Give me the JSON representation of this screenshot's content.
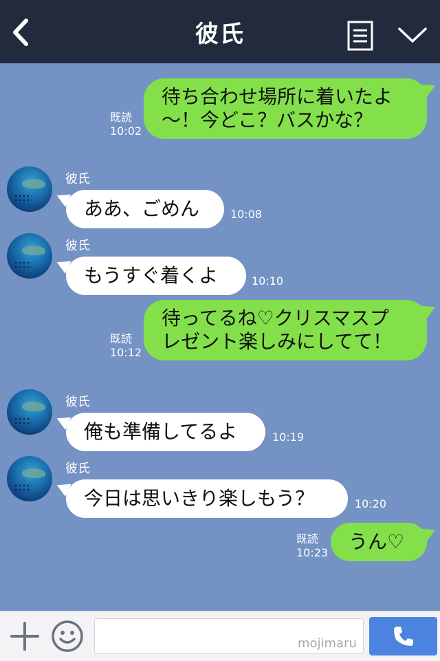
{
  "header": {
    "title": "彼氏",
    "back_icon": "chevron-left-icon",
    "memo_icon": "memo-icon",
    "menu_icon": "chevron-down-icon"
  },
  "messages": [
    {
      "side": "me",
      "lines": [
        "待ち合わせ場所に着いたよ",
        "〜！今どこ？バスかな？"
      ],
      "read": "既読",
      "time": "10:02"
    },
    {
      "side": "them",
      "sender": "彼氏",
      "lines": [
        "ああ、ごめん"
      ],
      "time": "10:08"
    },
    {
      "side": "them",
      "sender": "彼氏",
      "lines": [
        "もうすぐ着くよ"
      ],
      "time": "10:10"
    },
    {
      "side": "me",
      "lines": [
        "待ってるね♡クリスマスプ",
        "レゼント楽しみにしてて！"
      ],
      "read": "既読",
      "time": "10:12"
    },
    {
      "side": "them",
      "sender": "彼氏",
      "lines": [
        "俺も準備してるよ"
      ],
      "time": "10:19"
    },
    {
      "side": "them",
      "sender": "彼氏",
      "lines": [
        "今日は思いきり楽しもう？"
      ],
      "time": "10:20"
    },
    {
      "side": "me",
      "lines": [
        "うん♡"
      ],
      "read": "既読",
      "time": "10:23"
    }
  ],
  "footer": {
    "input_value": "",
    "watermark": "mojimaru",
    "plus_icon": "plus-icon",
    "emoji_icon": "smiley-icon",
    "call_icon": "phone-icon"
  },
  "colors": {
    "header_bg": "#222b3e",
    "chat_bg": "#7492c4",
    "my_bubble": "#84e04a",
    "their_bubble": "#ffffff",
    "call_button": "#4d83e0"
  }
}
